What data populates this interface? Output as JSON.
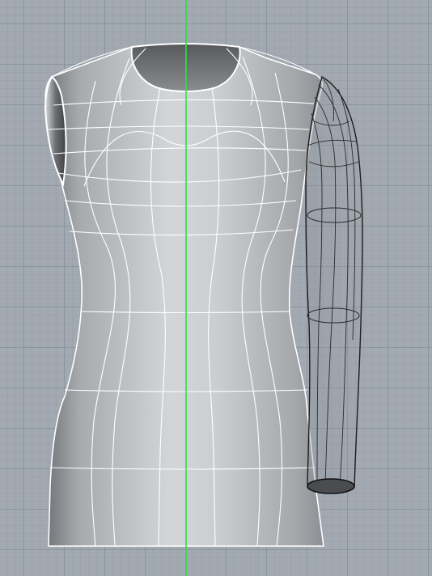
{
  "viewport": {
    "view": "perspective-front",
    "background_color": "#a2a9b1",
    "grid_color": "#8a929c",
    "axis_color": "#2ee043",
    "wire_color": "#ffffff",
    "arm_wire_color": "#2b2b2b"
  },
  "model": {
    "object": "dress-form-torso-with-sleeve",
    "surface_color": "#c6c8ca",
    "shaded_edge_color": "#6f7275"
  }
}
